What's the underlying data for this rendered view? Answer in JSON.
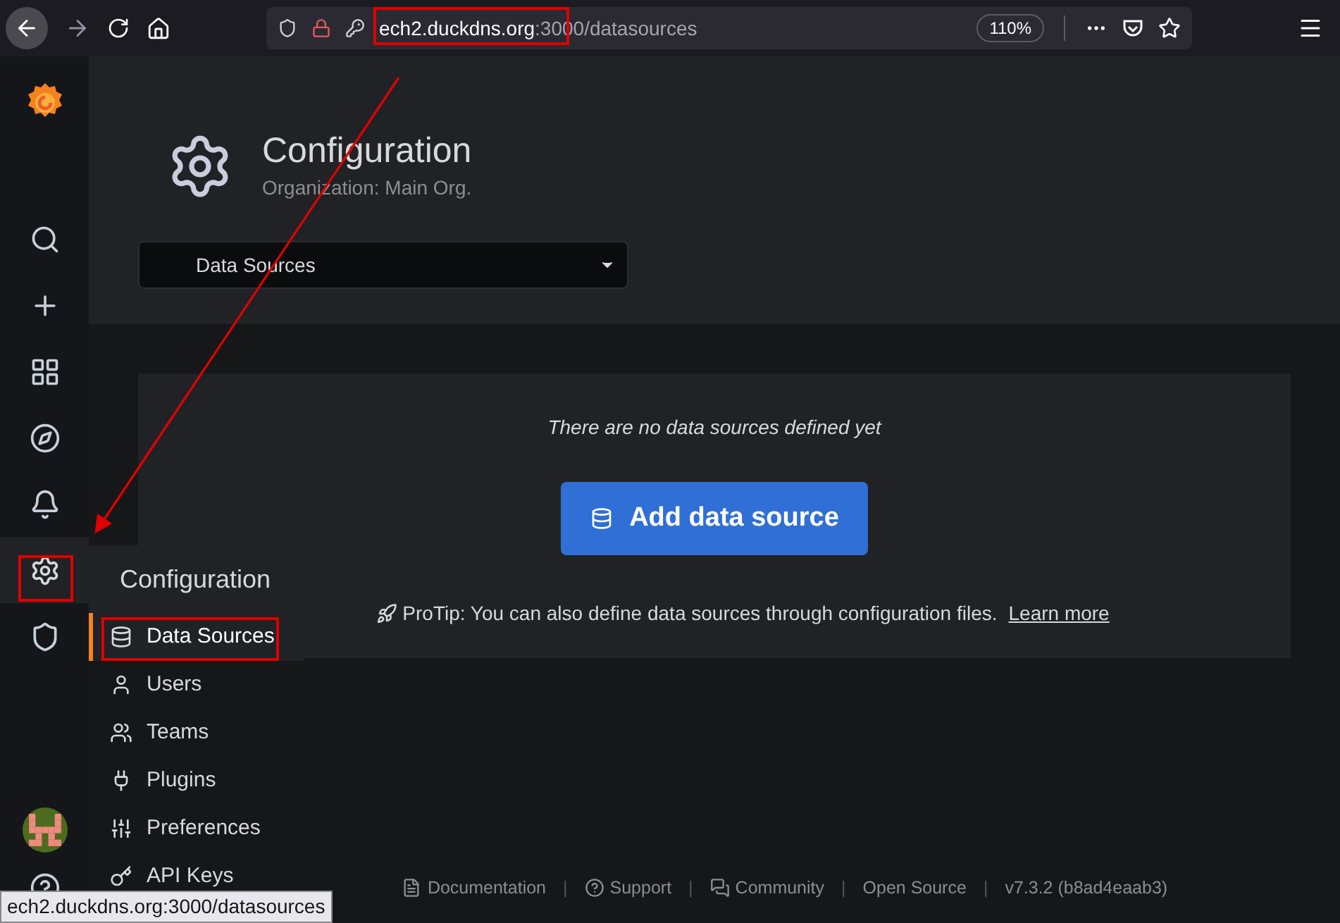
{
  "browser": {
    "url_host": "ech2.duckdns.org",
    "url_rest": ":3000/datasources",
    "zoom": "110%"
  },
  "sidebar": {
    "items": [
      {
        "selected": false
      },
      {
        "selected": false
      },
      {
        "selected": false
      },
      {
        "selected": false
      },
      {
        "selected": false
      },
      {
        "selected": true
      },
      {
        "selected": false
      }
    ]
  },
  "page_header": {
    "title": "Configuration",
    "subtitle": "Organization: Main Org.",
    "nav_select": "Data Sources"
  },
  "empty_state": {
    "message": "There are no data sources defined yet",
    "button": "Add data source",
    "protip": "ProTip: You can also define data sources through configuration files.",
    "link": "Learn more"
  },
  "menu": {
    "title": "Configuration",
    "items": [
      {
        "label": "Data Sources",
        "selected": true
      },
      {
        "label": "Users",
        "selected": false
      },
      {
        "label": "Teams",
        "selected": false
      },
      {
        "label": "Plugins",
        "selected": false
      },
      {
        "label": "Preferences",
        "selected": false
      },
      {
        "label": "API Keys",
        "selected": false
      }
    ]
  },
  "footer": {
    "separator": "|",
    "links": [
      "Documentation",
      "Support",
      "Community",
      "Open Source"
    ],
    "version": "v7.3.2 (b8ad4eaab3)"
  },
  "status_bar": {
    "url": "ech2.duckdns.org:3000/datasources"
  }
}
